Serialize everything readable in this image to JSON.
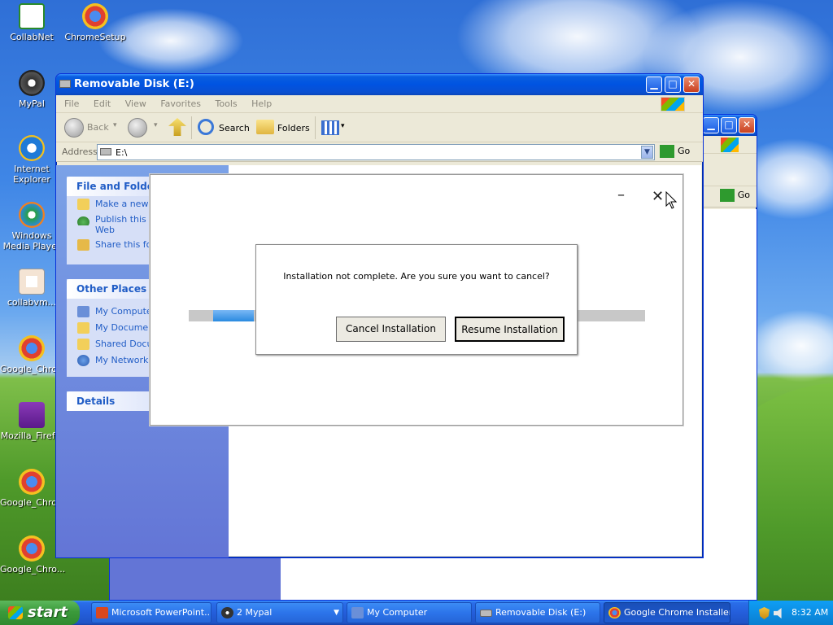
{
  "desktop": {
    "icons": [
      {
        "label": "CollabNet",
        "icon": "collabnet-icon"
      },
      {
        "label": "ChromeSetup",
        "icon": "chrome-setup-icon"
      },
      {
        "label": "MyPal",
        "icon": "mypal-icon"
      },
      {
        "label": "Internet Explorer",
        "icon": "internet-explorer-icon"
      },
      {
        "label": "Windows Media Player",
        "icon": "media-player-icon"
      },
      {
        "label": "collabvm...",
        "icon": "powerpoint-file-icon"
      },
      {
        "label": "Google_Chro...",
        "icon": "chrome-installer-icon"
      },
      {
        "label": "Mozilla_Firef...",
        "icon": "firefox-installer-icon"
      },
      {
        "label": "Google_Chro...",
        "icon": "chrome-installer-icon"
      },
      {
        "label": "Google_Chro...",
        "icon": "chrome-installer-icon"
      }
    ]
  },
  "explorer": {
    "title": "Removable Disk (E:)",
    "menu": [
      "File",
      "Edit",
      "View",
      "Favorites",
      "Tools",
      "Help"
    ],
    "toolbar": {
      "back": "Back",
      "search": "Search",
      "folders": "Folders"
    },
    "address": {
      "label": "Address",
      "value": "E:\\",
      "go": "Go"
    },
    "taskpane": {
      "file_folder_tasks": {
        "title": "File and Folder T",
        "items": [
          "Make a new fo",
          "Publish this fo",
          "Web",
          "Share this fold"
        ]
      },
      "other_places": {
        "title": "Other Places",
        "items": [
          "My Computer",
          "My Document",
          "Shared Docun",
          "My Network P"
        ]
      },
      "details": {
        "title": "Details"
      }
    }
  },
  "back_window": {
    "go": "Go"
  },
  "installer": {
    "minimize": "–",
    "close": "✕",
    "progress_fraction": 0.09
  },
  "confirm_dialog": {
    "message": "Installation not complete. Are you sure you want to cancel?",
    "cancel_label": "Cancel Installation",
    "resume_label": "Resume Installation"
  },
  "taskbar": {
    "start": "start",
    "tasks": [
      {
        "label": "Microsoft PowerPoint...",
        "icon": "powerpoint-icon",
        "active": false
      },
      {
        "label": "2 Mypal",
        "icon": "mypal-icon",
        "active": false
      },
      {
        "label": "My Computer",
        "icon": "my-computer-icon",
        "active": false
      },
      {
        "label": "Removable Disk (E:)",
        "icon": "drive-icon",
        "active": false
      },
      {
        "label": "Google Chrome Installer",
        "icon": "chrome-installer-icon",
        "active": true
      }
    ],
    "clock": "8:32 AM"
  }
}
